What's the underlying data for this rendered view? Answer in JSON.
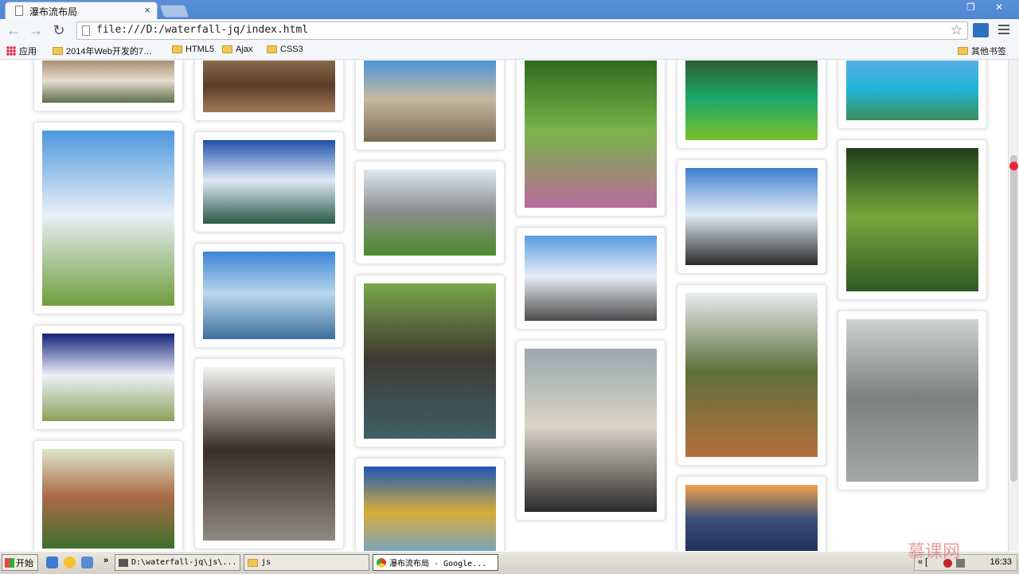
{
  "browser": {
    "tab_title": "瀑布流布局",
    "tab_close": "×",
    "url": "file:///D:/waterfall-jq/index.html",
    "window_controls": {
      "restore": "❐",
      "close": "✕"
    }
  },
  "bookmarks": {
    "apps_label": "应用",
    "items": [
      "2014年Web开发的7…",
      "HTML5",
      "Ajax",
      "CSS3"
    ],
    "other": "其他书签"
  },
  "waterfall": {
    "columns": [
      [
        {
          "caption": "village-path",
          "colors": [
            "#a98f72",
            "#e4ddd1",
            "#5e7046"
          ]
        },
        {
          "caption": "wetland",
          "colors": [
            "#4c97dd",
            "#e9f0f8",
            "#6f9d3a"
          ]
        },
        {
          "caption": "white-pagoda",
          "colors": [
            "#13247a",
            "#eef1f8",
            "#8aa15a"
          ]
        },
        {
          "caption": "castle-hill",
          "colors": [
            "#dde7cc",
            "#aa6a46",
            "#3f6f2d"
          ]
        }
      ],
      [
        {
          "caption": "brown-ground",
          "colors": [
            "#8a6a4c",
            "#5a3d26",
            "#a07a56"
          ]
        },
        {
          "caption": "karst-lake",
          "colors": [
            "#1c4fa8",
            "#dfe9f6",
            "#285a47"
          ]
        },
        {
          "caption": "lone-tree-lake",
          "colors": [
            "#3a86d4",
            "#b9d6ee",
            "#3d6f9a"
          ]
        },
        {
          "caption": "lantern-street",
          "colors": [
            "#f5f5f3",
            "#3a2e25",
            "#8d8a83"
          ]
        }
      ],
      [
        {
          "caption": "rock-cliff",
          "colors": [
            "#4d95d8",
            "#c6b99f",
            "#7b6a52"
          ]
        },
        {
          "caption": "stone-forest",
          "colors": [
            "#dfe7ef",
            "#8c8f8d",
            "#4c8b2c"
          ]
        },
        {
          "caption": "canal-town",
          "colors": [
            "#7aa84a",
            "#3f3a32",
            "#3f5f66"
          ]
        },
        {
          "caption": "golden-tree",
          "colors": [
            "#1d56b5",
            "#d7ae3a",
            "#5ea0e0"
          ]
        }
      ],
      [
        {
          "caption": "forest-steps",
          "colors": [
            "#2f6a1e",
            "#7ab44a",
            "#b76b9b"
          ]
        },
        {
          "caption": "snow-hut",
          "colors": [
            "#5a9be0",
            "#e6eef5",
            "#4b4b4b"
          ]
        },
        {
          "caption": "rice-terraces",
          "colors": [
            "#9ba8ae",
            "#d9d4c6",
            "#2a2a2a"
          ]
        }
      ],
      [
        {
          "caption": "green-lake",
          "colors": [
            "#2f5d32",
            "#19a96a",
            "#7bbf2b"
          ]
        },
        {
          "caption": "gull-sculpture",
          "colors": [
            "#3d7ed0",
            "#e1ecf5",
            "#2b2b2b"
          ]
        },
        {
          "caption": "gorge-river",
          "colors": [
            "#e9ecef",
            "#5f6f3a",
            "#b3703f"
          ]
        },
        {
          "caption": "sunset-sea",
          "colors": [
            "#f2a24a",
            "#3a4f7a",
            "#1b2c52"
          ]
        }
      ],
      [
        {
          "caption": "tropical-island",
          "colors": [
            "#5aaee6",
            "#1fb5d6",
            "#3c8d5a"
          ]
        },
        {
          "caption": "bamboo-forest",
          "colors": [
            "#1f3e1a",
            "#79a63a",
            "#2e5a25"
          ]
        },
        {
          "caption": "balancing-rock",
          "colors": [
            "#d0d2d3",
            "#7e8080",
            "#a6a8a8"
          ]
        }
      ]
    ]
  },
  "taskbar": {
    "start": "开始",
    "chevron": "»",
    "windows": [
      "D:\\waterfall-jq\\js\\...",
      "js",
      "瀑布流布局 - Google..."
    ],
    "tray_prefix": "« [",
    "clock": "16:33"
  },
  "watermark": "慕课网"
}
